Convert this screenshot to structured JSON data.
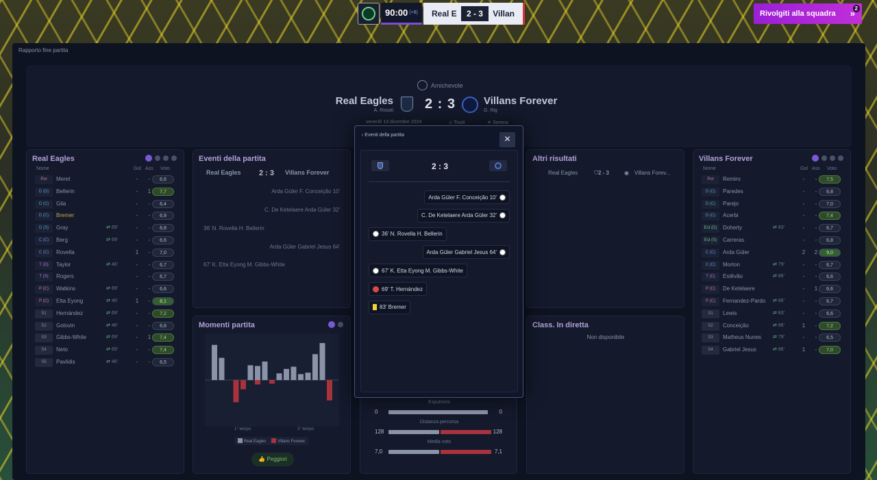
{
  "topbar": {
    "clock": "90:00",
    "added_time": "(+8)",
    "home_short": "Real E",
    "score": "2 - 3",
    "away_short": "Villan",
    "team_talk": "Rivolgiti alla squadra",
    "talk_badge": "2"
  },
  "report_title": "Rapporto fine partita",
  "header": {
    "competition": "Amichevole",
    "home_team": "Real Eagles",
    "home_manager": "A. Rosati",
    "away_team": "Villans Forever",
    "away_manager": "G. Rig",
    "score": "2 : 3",
    "date": "venerdì 13 dicembre 2024",
    "venue": "Tivoli",
    "weather": "Sereno"
  },
  "home_roster": {
    "title": "Real Eagles",
    "col_name": "Nome",
    "col_gol": "Gol",
    "col_ass": "Ass",
    "col_voto": "Voto",
    "rows": [
      {
        "pos": "Por",
        "name": "Meret",
        "sub": "",
        "g": "-",
        "a": "-",
        "r": "6,6",
        "hl": ""
      },
      {
        "pos": "D (D)",
        "name": "Bellerin",
        "sub": "",
        "g": "-",
        "a": "1",
        "r": "7,7",
        "hl": "green"
      },
      {
        "pos": "D (C)",
        "name": "Gila",
        "sub": "",
        "g": "-",
        "a": "-",
        "r": "6,4",
        "hl": ""
      },
      {
        "pos": "D (C)",
        "name": "Bremer",
        "sub": "",
        "g": "-",
        "a": "-",
        "r": "6,9",
        "hl": ""
      },
      {
        "pos": "D (S)",
        "name": "Gray",
        "sub": "69'",
        "g": "-",
        "a": "-",
        "r": "6,8",
        "hl": ""
      },
      {
        "pos": "C (C)",
        "name": "Berg",
        "sub": "69'",
        "g": "-",
        "a": "-",
        "r": "6,6",
        "hl": ""
      },
      {
        "pos": "C (C)",
        "name": "Rovella",
        "sub": "",
        "g": "1",
        "a": "-",
        "r": "7,0",
        "hl": ""
      },
      {
        "pos": "T (D)",
        "name": "Taylor",
        "sub": "46'",
        "g": "-",
        "a": "-",
        "r": "6,7",
        "hl": ""
      },
      {
        "pos": "T (S)",
        "name": "Rogers",
        "sub": "",
        "g": "-",
        "a": "-",
        "r": "6,7",
        "hl": ""
      },
      {
        "pos": "P (C)",
        "name": "Watkins",
        "sub": "69'",
        "g": "-",
        "a": "-",
        "r": "6,6",
        "hl": ""
      },
      {
        "pos": "P (C)",
        "name": "Etta Eyong",
        "sub": "46'",
        "g": "1",
        "a": "-",
        "r": "8,1",
        "hl": "greenbright"
      },
      {
        "pos": "S1",
        "name": "Hernández",
        "sub": "69'",
        "g": "-",
        "a": "-",
        "r": "7,2",
        "hl": "green"
      },
      {
        "pos": "S2",
        "name": "Golovin",
        "sub": "46'",
        "g": "-",
        "a": "-",
        "r": "6,6",
        "hl": ""
      },
      {
        "pos": "S3",
        "name": "Gibbs-White",
        "sub": "69'",
        "g": "-",
        "a": "1",
        "r": "7,4",
        "hl": "green"
      },
      {
        "pos": "S4",
        "name": "Neto",
        "sub": "69'",
        "g": "-",
        "a": "-",
        "r": "7,4",
        "hl": "green"
      },
      {
        "pos": "S5",
        "name": "Pavlidis",
        "sub": "46'",
        "g": "-",
        "a": "-",
        "r": "6,5",
        "hl": ""
      }
    ]
  },
  "away_roster": {
    "title": "Villans Forever",
    "col_name": "Nome",
    "col_gol": "Gol",
    "col_ass": "Ass",
    "col_voto": "Voto",
    "rows": [
      {
        "pos": "Por",
        "name": "Remiro",
        "sub": "",
        "g": "-",
        "a": "-",
        "r": "7,5",
        "hl": "green"
      },
      {
        "pos": "D (C)",
        "name": "Paredes",
        "sub": "",
        "g": "-",
        "a": "-",
        "r": "6,8",
        "hl": ""
      },
      {
        "pos": "D (C)",
        "name": "Parejo",
        "sub": "",
        "g": "-",
        "a": "-",
        "r": "7,0",
        "hl": ""
      },
      {
        "pos": "D (C)",
        "name": "Acerbi",
        "sub": "",
        "g": "-",
        "a": "-",
        "r": "7,4",
        "hl": "green"
      },
      {
        "pos": "Est (D)",
        "name": "Doherty",
        "sub": "83'",
        "g": "-",
        "a": "-",
        "r": "6,7",
        "hl": ""
      },
      {
        "pos": "Est (S)",
        "name": "Carreras",
        "sub": "",
        "g": "-",
        "a": "-",
        "r": "6,8",
        "hl": ""
      },
      {
        "pos": "C (C)",
        "name": "Arda Güler",
        "sub": "",
        "g": "2",
        "a": "2",
        "r": "9,0",
        "hl": "greenbright"
      },
      {
        "pos": "C (C)",
        "name": "Morton",
        "sub": "79'",
        "g": "-",
        "a": "-",
        "r": "6,7",
        "hl": ""
      },
      {
        "pos": "T (C)",
        "name": "Estêvão",
        "sub": "86'",
        "g": "-",
        "a": "-",
        "r": "6,6",
        "hl": ""
      },
      {
        "pos": "P (C)",
        "name": "De Ketelaere",
        "sub": "",
        "g": "-",
        "a": "1",
        "r": "6,6",
        "hl": ""
      },
      {
        "pos": "P (C)",
        "name": "Fernandez-Pardo",
        "sub": "86'",
        "g": "-",
        "a": "-",
        "r": "6,7",
        "hl": ""
      },
      {
        "pos": "S1",
        "name": "Lewis",
        "sub": "83'",
        "g": "-",
        "a": "-",
        "r": "6,6",
        "hl": ""
      },
      {
        "pos": "S2",
        "name": "Conceição",
        "sub": "86'",
        "g": "1",
        "a": "-",
        "r": "7,2",
        "hl": "green"
      },
      {
        "pos": "S3",
        "name": "Matheus Nunes",
        "sub": "79'",
        "g": "-",
        "a": "-",
        "r": "6,5",
        "hl": ""
      },
      {
        "pos": "S4",
        "name": "Gabriel Jesus",
        "sub": "86'",
        "g": "1",
        "a": "-",
        "r": "7,0",
        "hl": "green"
      }
    ]
  },
  "events_card": {
    "title": "Eventi della partita",
    "home": "Real Eagles",
    "score": "2 : 3",
    "away": "Villans Forever",
    "items": [
      "Arda Güler  F. Conceição  10'",
      "C. De Ketelaere  Arda Güler  32'",
      "36'  N. Rovella  H. Bellerin",
      "Arda Güler  Gabriel Jesus  64'",
      "67'  K. Etta Eyong  M. Gibbs-White"
    ]
  },
  "moments_card": {
    "title": "Momenti partita",
    "first_half": "1° tempo",
    "second_half": "2° tempo",
    "legend_home": "Real Eagles",
    "legend_away": "Villans Forever",
    "best_button": "Peggiori"
  },
  "modal": {
    "title": "Eventi della partita",
    "close": "✕",
    "score": "2 : 3",
    "events": [
      {
        "text": "Arda Güler  F. Conceição  10'",
        "side": "away",
        "icon": "goal"
      },
      {
        "text": "C. De Ketelaere  Arda Güler  32'",
        "side": "away",
        "icon": "goal"
      },
      {
        "text": "36'  N. Rovella  H. Bellerin",
        "side": "home",
        "icon": "goal"
      },
      {
        "text": "Arda Güler  Gabriel Jesus  64'",
        "side": "away",
        "icon": "goal"
      },
      {
        "text": "67'  K. Etta Eyong  M. Gibbs-White",
        "side": "home",
        "icon": "goal"
      },
      {
        "text": "69'  T. Hernández",
        "side": "home",
        "icon": "injury"
      },
      {
        "text": "83'  Bremer",
        "side": "home",
        "icon": "yellow"
      }
    ]
  },
  "stats": {
    "rows": [
      {
        "label": "Espulsioni",
        "home": "0",
        "away": "0",
        "home_frac": 0.98,
        "away_frac": 0
      },
      {
        "label": "Distanza percorsa",
        "home": "128",
        "away": "128",
        "home_frac": 0.5,
        "away_frac": 0.5
      },
      {
        "label": "Media voto",
        "home": "7,0",
        "away": "7,1",
        "home_frac": 0.5,
        "away_frac": 0.5
      }
    ]
  },
  "other_results": {
    "title": "Altri risultati",
    "home": "Real Eagles",
    "score": "2 - 3",
    "away": "Villans Forev..."
  },
  "live_table": {
    "title": "Class. In diretta",
    "text": "Non disponibile"
  },
  "chart_data": {
    "type": "bar",
    "series": [
      {
        "name": "Real Eagles",
        "values": [
          0.95,
          0.6,
          0,
          0,
          0,
          0.4,
          0.38,
          0.5,
          0,
          0.18,
          0.3,
          0.36,
          0.16,
          0.2,
          0.7,
          1.0,
          0
        ]
      },
      {
        "name": "Villans Forever",
        "values": [
          0,
          0,
          0,
          -0.6,
          -0.25,
          0,
          -0.12,
          0,
          -0.1,
          0,
          0,
          0,
          0,
          0,
          0,
          0,
          -0.55
        ]
      }
    ]
  }
}
